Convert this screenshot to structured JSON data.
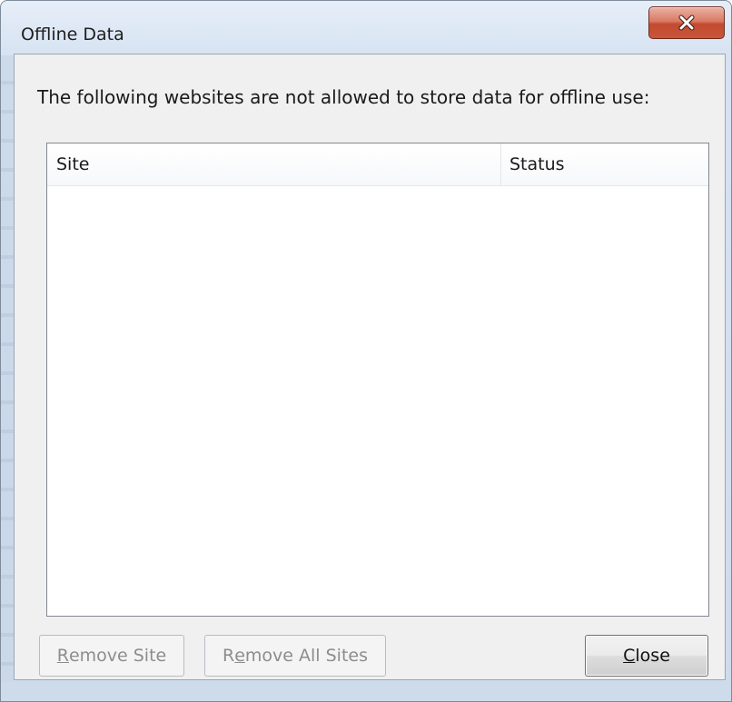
{
  "window": {
    "title": "Offline Data",
    "close_icon": "close-x-icon"
  },
  "dialog": {
    "description": "The following websites are not allowed to store data for offline use:"
  },
  "table": {
    "columns": [
      "Site",
      "Status"
    ],
    "rows": []
  },
  "buttons": {
    "remove_site": {
      "mnemonic": "R",
      "rest": "emove Site",
      "enabled": false
    },
    "remove_all_sites": {
      "before": "R",
      "mnemonic": "e",
      "rest": "move All Sites",
      "enabled": false
    },
    "close": {
      "mnemonic": "C",
      "rest": "lose",
      "enabled": true
    }
  },
  "colors": {
    "close_button_red": "#c24a30",
    "dialog_bg": "#f0f0f0",
    "title_gradient": "#d7e3f2"
  }
}
